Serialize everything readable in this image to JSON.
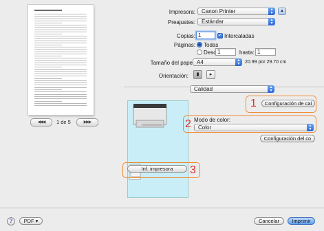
{
  "preview": {
    "nav": {
      "first": "◀◀",
      "prev": "◀",
      "page_indicator": "1 de 5",
      "next": "▶",
      "last": "▶▶"
    }
  },
  "printer": {
    "label": "Impresora:",
    "value": "Canon Printer"
  },
  "presets": {
    "label": "Preajustes:",
    "value": "Estándar"
  },
  "copies": {
    "label": "Copias:",
    "value": "1",
    "collate_label": "Intercaladas",
    "collate_checked": true
  },
  "pages": {
    "label": "Páginas:",
    "all_label": "Todas",
    "from_label": "Desde:",
    "from_value": "1",
    "to_label": "hasta:",
    "to_value": "1",
    "selected": "all"
  },
  "paper_size": {
    "label": "Tamaño del papel:",
    "value": "A4",
    "dimensions": "20.99 por 29.70 cm"
  },
  "orientation": {
    "label": "Orientación:",
    "selected": "portrait"
  },
  "panel": {
    "value": "Calidad"
  },
  "quality": {
    "config_button": "Configuración de cal",
    "color_mode_label": "Modo de color:",
    "color_mode_value": "Color",
    "color_config_button": "Configuración del co",
    "printer_info_button": "Inf. impresora"
  },
  "callouts": {
    "one": "1",
    "two": "2",
    "three": "3"
  },
  "footer": {
    "help": "?",
    "pdf_label": "PDF ▾",
    "cancel_label": "Cancelar",
    "print_label": "Imprimir"
  }
}
